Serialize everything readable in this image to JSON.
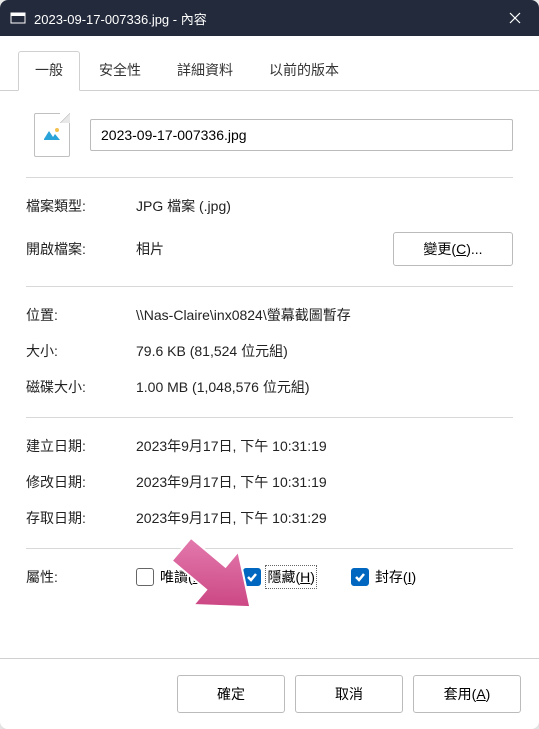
{
  "titlebar": {
    "title": "2023-09-17-007336.jpg - 內容"
  },
  "tabs": [
    {
      "label": "一般",
      "active": true
    },
    {
      "label": "安全性",
      "active": false
    },
    {
      "label": "詳細資料",
      "active": false
    },
    {
      "label": "以前的版本",
      "active": false
    }
  ],
  "filename": "2023-09-17-007336.jpg",
  "info": {
    "file_type_label": "檔案類型:",
    "file_type_value": "JPG 檔案 (.jpg)",
    "open_with_label": "開啟檔案:",
    "open_with_value": "相片",
    "change_label": "變更(",
    "change_key": "C",
    "change_suffix": ")...",
    "location_label": "位置:",
    "location_value": "\\\\Nas-Claire\\inx0824\\螢幕截圖暫存",
    "size_label": "大小:",
    "size_value": "79.6 KB (81,524 位元組)",
    "disk_size_label": "磁碟大小:",
    "disk_size_value": "1.00 MB (1,048,576 位元組)",
    "created_label": "建立日期:",
    "created_value": "2023年9月17日, 下午 10:31:19",
    "modified_label": "修改日期:",
    "modified_value": "2023年9月17日, 下午 10:31:19",
    "accessed_label": "存取日期:",
    "accessed_value": "2023年9月17日, 下午 10:31:29",
    "attrs_label": "屬性:"
  },
  "attrs": {
    "readonly_label": "唯讀(",
    "readonly_key": "R",
    "readonly_suffix": ")",
    "readonly_checked": false,
    "hidden_label": "隱藏(",
    "hidden_key": "H",
    "hidden_suffix": ")",
    "hidden_checked": true,
    "archive_label": "封存(",
    "archive_key": "I",
    "archive_suffix": ")",
    "archive_checked": true
  },
  "footer": {
    "ok": "確定",
    "cancel": "取消",
    "apply_prefix": "套用(",
    "apply_key": "A",
    "apply_suffix": ")"
  }
}
